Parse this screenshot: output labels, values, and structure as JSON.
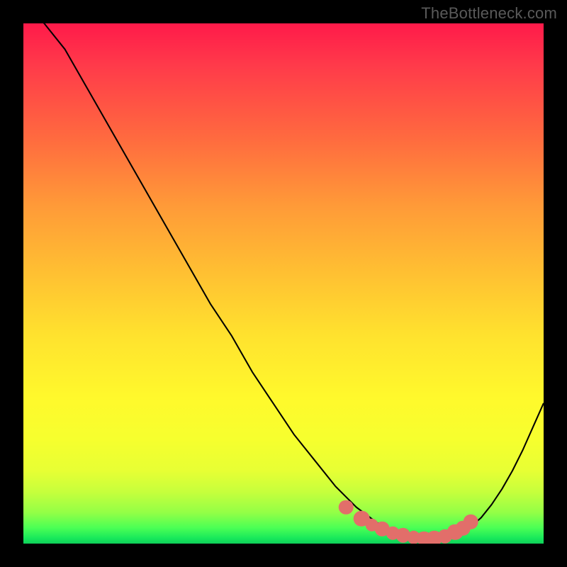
{
  "watermark": "TheBottleneck.com",
  "colors": {
    "frame": "#000000",
    "curve": "#000000",
    "marker": "#e26e6a",
    "gradient_stops": [
      "#ff1a4a",
      "#ff3a4a",
      "#ff6a3f",
      "#ff9a38",
      "#ffc032",
      "#ffe22e",
      "#fff92c",
      "#f6ff2e",
      "#e7ff34",
      "#c7ff3c",
      "#94ff46",
      "#4aff55",
      "#17e85b",
      "#0fcf59"
    ]
  },
  "chart_data": {
    "type": "line",
    "title": "",
    "xlabel": "",
    "ylabel": "",
    "xlim": [
      0,
      100
    ],
    "ylim": [
      0,
      100
    ],
    "x": [
      0,
      4,
      8,
      12,
      16,
      20,
      24,
      28,
      32,
      36,
      40,
      44,
      48,
      52,
      56,
      60,
      62,
      64,
      66,
      68,
      70,
      72,
      74,
      76,
      78,
      80,
      82,
      84,
      86,
      88,
      90,
      92,
      94,
      96,
      98,
      100
    ],
    "values": [
      104,
      100,
      95,
      88,
      81,
      74,
      67,
      60,
      53,
      46,
      40,
      33,
      27,
      21,
      16,
      11,
      9,
      7,
      5.5,
      4,
      3,
      2.2,
      1.6,
      1.2,
      1.0,
      1.0,
      1.3,
      2.0,
      3.2,
      5.0,
      7.5,
      10.5,
      14,
      18,
      22.5,
      27
    ],
    "legend": false,
    "annotations": [],
    "markers": {
      "note": "trough-region markers",
      "points": [
        {
          "x": 62,
          "y": 7.0,
          "r": 1.0
        },
        {
          "x": 65,
          "y": 4.8,
          "r": 1.1
        },
        {
          "x": 67,
          "y": 3.6,
          "r": 0.9
        },
        {
          "x": 69,
          "y": 2.8,
          "r": 1.0
        },
        {
          "x": 71,
          "y": 2.0,
          "r": 0.9
        },
        {
          "x": 73,
          "y": 1.6,
          "r": 1.0
        },
        {
          "x": 75,
          "y": 1.2,
          "r": 0.9
        },
        {
          "x": 77,
          "y": 1.0,
          "r": 1.0
        },
        {
          "x": 79,
          "y": 1.0,
          "r": 1.1
        },
        {
          "x": 81,
          "y": 1.4,
          "r": 1.0
        },
        {
          "x": 83,
          "y": 2.2,
          "r": 1.1
        },
        {
          "x": 84.5,
          "y": 3.0,
          "r": 1.0
        },
        {
          "x": 86,
          "y": 4.2,
          "r": 1.0
        }
      ]
    }
  }
}
